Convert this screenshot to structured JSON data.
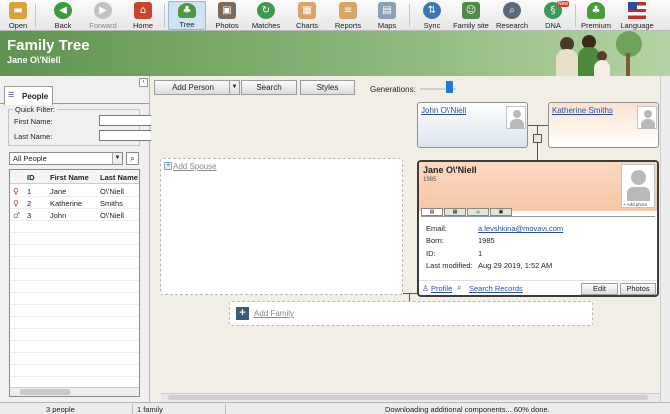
{
  "toolbar": {
    "items": [
      {
        "label": "Open",
        "icon": "folder-icon",
        "color": "#d8a43a"
      },
      {
        "label": "Back",
        "icon": "back-arrow-icon",
        "color": "#3f9a3a"
      },
      {
        "label": "Forward",
        "icon": "forward-arrow-icon",
        "color": "#b8b8b8"
      },
      {
        "label": "Home",
        "icon": "home-icon",
        "color": "#c9442e"
      },
      {
        "label": "Tree",
        "icon": "tree-icon",
        "color": "#4c9a3b"
      },
      {
        "label": "Photos",
        "icon": "photos-icon",
        "color": "#7d6a5a"
      },
      {
        "label": "Matches",
        "icon": "matches-icon",
        "color": "#3d9a4a"
      },
      {
        "label": "Charts",
        "icon": "charts-icon",
        "color": "#d9a66a"
      },
      {
        "label": "Reports",
        "icon": "reports-icon",
        "color": "#d9a66a"
      },
      {
        "label": "Maps",
        "icon": "maps-icon",
        "color": "#8aa0b4"
      },
      {
        "label": "Sync",
        "icon": "sync-icon",
        "color": "#3b76b6"
      },
      {
        "label": "Family site",
        "icon": "family-site-icon",
        "color": "#4f8a4a"
      },
      {
        "label": "Research",
        "icon": "research-icon",
        "color": "#5a6a7a"
      },
      {
        "label": "DNA",
        "icon": "dna-icon",
        "color": "#3a9a5a",
        "badge": "New"
      },
      {
        "label": "Premium",
        "icon": "premium-icon",
        "color": "#4c9a3b"
      },
      {
        "label": "Language",
        "icon": "flag-icon",
        "color": "#2a4e9a"
      }
    ]
  },
  "header": {
    "title": "Family Tree",
    "subtitle": "Jane O\\'Niell"
  },
  "left_panel": {
    "tab_label": "People",
    "quick_filter": {
      "legend": "Quick Filter:",
      "first_name_label": "First Name:",
      "last_name_label": "Last Name:",
      "first_name_value": "",
      "last_name_value": ""
    },
    "filter_dropdown": "All People",
    "columns": [
      "ID",
      "First Name",
      "Last Name"
    ],
    "rows": [
      {
        "id": "1",
        "first": "Jane",
        "last": "O\\'Niell"
      },
      {
        "id": "2",
        "first": "Katherine",
        "last": "Smiths"
      },
      {
        "id": "3",
        "first": "John",
        "last": "O\\'Niell"
      }
    ]
  },
  "canvas": {
    "buttons": {
      "add_person": "Add Person",
      "search": "Search",
      "styles": "Styles"
    },
    "generations_label": "Generations:",
    "father": {
      "name": "John O\\'Niell"
    },
    "mother": {
      "name": "Katherine Smiths"
    },
    "add_spouse": "Add Spouse",
    "add_family": "Add Family",
    "main_person": {
      "name": "Jane O\\'Niell",
      "year": "1985",
      "add_photo": "+ Add photo",
      "fields": [
        {
          "label": "Email:",
          "value": "a.levshkina@movavi.com",
          "link": true
        },
        {
          "label": "Born:",
          "value": "1985"
        },
        {
          "label": "ID:",
          "value": "1"
        },
        {
          "label": "Last modified:",
          "value": "Aug 29 2019, 1:52 AM"
        }
      ],
      "profile_link": "Profile",
      "search_records_link": "Search Records",
      "edit_button": "Edit",
      "photos_button": "Photos"
    }
  },
  "status": {
    "people": "3 people",
    "family": "1 family",
    "message": "Downloading additional components... 60% done."
  }
}
